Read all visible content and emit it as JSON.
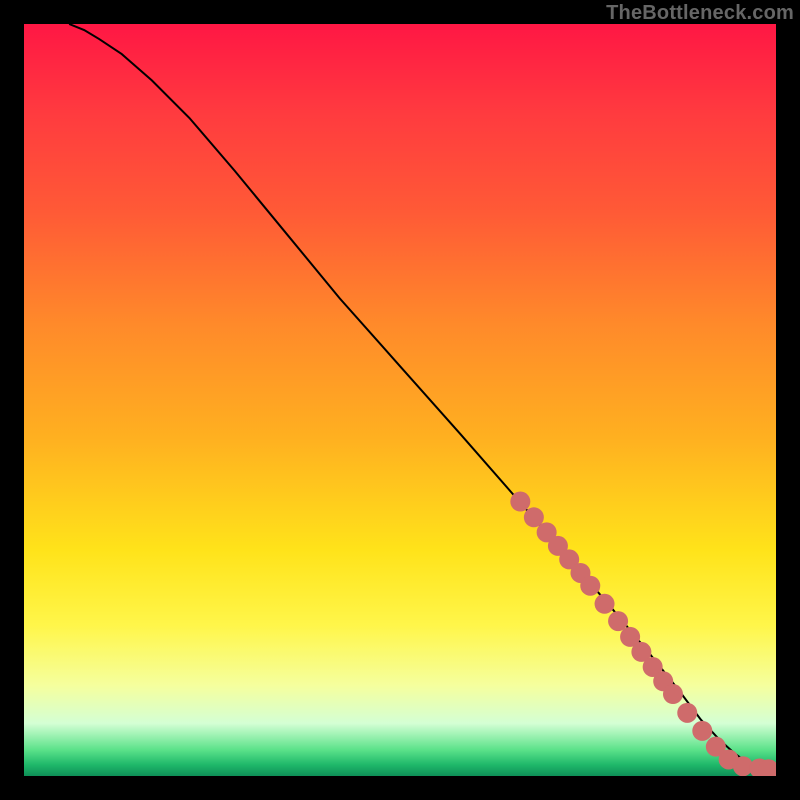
{
  "attribution": "TheBottleneck.com",
  "colors": {
    "dot": "#cf6b6b",
    "line": "#000000",
    "gradient_stops": [
      {
        "offset": 0.0,
        "color": "#ff1744"
      },
      {
        "offset": 0.12,
        "color": "#ff3b3f"
      },
      {
        "offset": 0.25,
        "color": "#ff5a36"
      },
      {
        "offset": 0.4,
        "color": "#ff8a2a"
      },
      {
        "offset": 0.55,
        "color": "#ffb020"
      },
      {
        "offset": 0.7,
        "color": "#ffe31a"
      },
      {
        "offset": 0.8,
        "color": "#fff64a"
      },
      {
        "offset": 0.88,
        "color": "#f5ff9e"
      },
      {
        "offset": 0.93,
        "color": "#d4ffd4"
      },
      {
        "offset": 0.965,
        "color": "#5ce28a"
      },
      {
        "offset": 0.985,
        "color": "#1fb86a"
      },
      {
        "offset": 1.0,
        "color": "#0e8f57"
      }
    ]
  },
  "chart_data": {
    "type": "line",
    "title": "",
    "xlabel": "",
    "ylabel": "",
    "xlim": [
      0,
      100
    ],
    "ylim": [
      0,
      100
    ],
    "grid": false,
    "series": [
      {
        "name": "curve",
        "x": [
          6,
          8,
          10,
          13,
          17,
          22,
          28,
          35,
          42,
          50,
          58,
          65,
          72,
          78,
          83,
          87,
          90,
          92.5,
          94.5,
          96,
          97.2,
          98.0,
          98.6,
          99.0
        ],
        "y": [
          100,
          99.2,
          98.0,
          96.0,
          92.5,
          87.5,
          80.5,
          72.0,
          63.5,
          54.5,
          45.5,
          37.5,
          29.5,
          22.5,
          16.5,
          11.5,
          7.5,
          4.8,
          3.0,
          1.9,
          1.3,
          1.0,
          0.9,
          0.9
        ]
      }
    ],
    "dots": [
      {
        "x": 66.0,
        "y": 36.5
      },
      {
        "x": 67.8,
        "y": 34.4
      },
      {
        "x": 69.5,
        "y": 32.4
      },
      {
        "x": 71.0,
        "y": 30.6
      },
      {
        "x": 72.5,
        "y": 28.8
      },
      {
        "x": 74.0,
        "y": 27.0
      },
      {
        "x": 75.3,
        "y": 25.3
      },
      {
        "x": 77.2,
        "y": 22.9
      },
      {
        "x": 79.0,
        "y": 20.6
      },
      {
        "x": 80.6,
        "y": 18.5
      },
      {
        "x": 82.1,
        "y": 16.5
      },
      {
        "x": 83.6,
        "y": 14.5
      },
      {
        "x": 85.0,
        "y": 12.6
      },
      {
        "x": 86.3,
        "y": 10.9
      },
      {
        "x": 88.2,
        "y": 8.4
      },
      {
        "x": 90.2,
        "y": 6.0
      },
      {
        "x": 92.0,
        "y": 3.9
      },
      {
        "x": 93.7,
        "y": 2.2
      },
      {
        "x": 95.6,
        "y": 1.3
      },
      {
        "x": 97.8,
        "y": 1.0
      },
      {
        "x": 99.0,
        "y": 0.9
      }
    ]
  }
}
